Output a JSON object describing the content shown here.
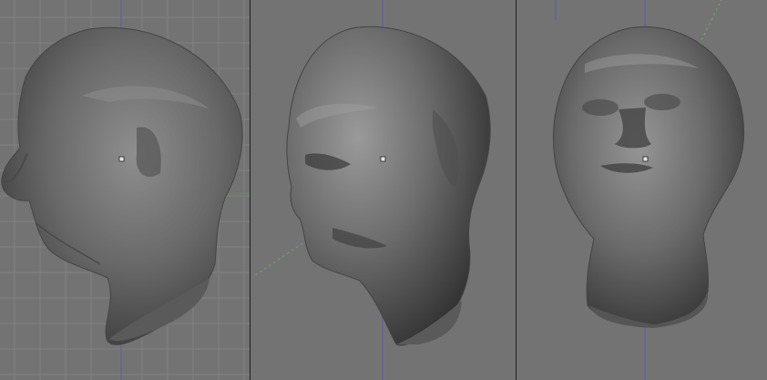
{
  "app": {
    "name": "",
    "view_mode": "solid"
  },
  "viewports": [
    {
      "id": "side",
      "view": "left-ortho",
      "grid": true,
      "object": "head-sculpt"
    },
    {
      "id": "persp",
      "view": "perspective",
      "grid": false,
      "object": "head-sculpt"
    },
    {
      "id": "front",
      "view": "front-ortho",
      "grid": false,
      "object": "head-sculpt"
    }
  ],
  "colors": {
    "background": "#737373",
    "grid_line": "#808080",
    "axis_blue": "#5a5ab4",
    "axis_green": "#5a9a5a",
    "splitter": "#1e1e1e",
    "mesh_base": "#6a6a6a",
    "mesh_shadow": "#3a3a3a",
    "mesh_highlight": "#9a9a9a"
  },
  "icons": {
    "object_origin": "origin-dot-icon"
  }
}
